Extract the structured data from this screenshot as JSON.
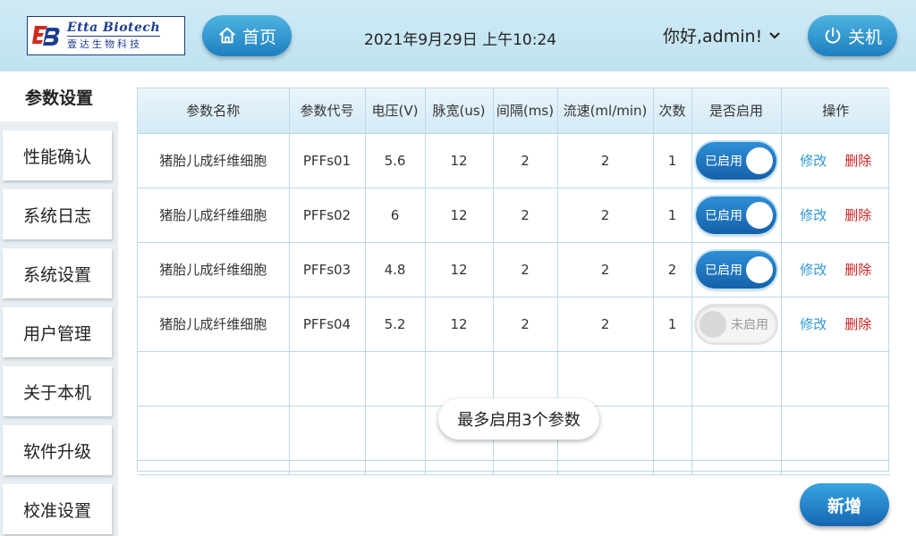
{
  "header": {
    "logo": {
      "en": "Etta Biotech",
      "cn": "壹达生物科技",
      "icon": "eb-logo-icon"
    },
    "home_label": "首页",
    "datetime": "2021年9月29日  上午10:24",
    "greeting": "你好,admin!",
    "power_label": "关机",
    "accent": "#1d7fc0"
  },
  "sidebar": {
    "items": [
      {
        "label": "参数设置",
        "active": true
      },
      {
        "label": "性能确认"
      },
      {
        "label": "系统日志"
      },
      {
        "label": "系统设置"
      },
      {
        "label": "用户管理"
      },
      {
        "label": "关于本机"
      },
      {
        "label": "软件升级"
      },
      {
        "label": "校准设置"
      }
    ]
  },
  "table": {
    "columns": [
      "参数名称",
      "参数代号",
      "电压(V)",
      "脉宽(us)",
      "间隔(ms)",
      "流速(ml/min)",
      "次数",
      "是否启用",
      "操作"
    ],
    "rows": [
      {
        "name": "猪胎儿成纤维细胞",
        "code": "PFFs01",
        "voltage": "5.6",
        "pulse": "12",
        "interval": "2",
        "flow": "2",
        "count": "1",
        "enabled": true,
        "status": "已启用"
      },
      {
        "name": "猪胎儿成纤维细胞",
        "code": "PFFs02",
        "voltage": "6",
        "pulse": "12",
        "interval": "2",
        "flow": "2",
        "count": "1",
        "enabled": true,
        "status": "已启用"
      },
      {
        "name": "猪胎儿成纤维细胞",
        "code": "PFFs03",
        "voltage": "4.8",
        "pulse": "12",
        "interval": "2",
        "flow": "2",
        "count": "2",
        "enabled": true,
        "status": "已启用"
      },
      {
        "name": "猪胎儿成纤维细胞",
        "code": "PFFs04",
        "voltage": "5.2",
        "pulse": "12",
        "interval": "2",
        "flow": "2",
        "count": "1",
        "enabled": false,
        "status": "未启用"
      }
    ],
    "edit_label": "修改",
    "delete_label": "删除"
  },
  "toast": "最多启用3个参数",
  "add_label": "新增"
}
